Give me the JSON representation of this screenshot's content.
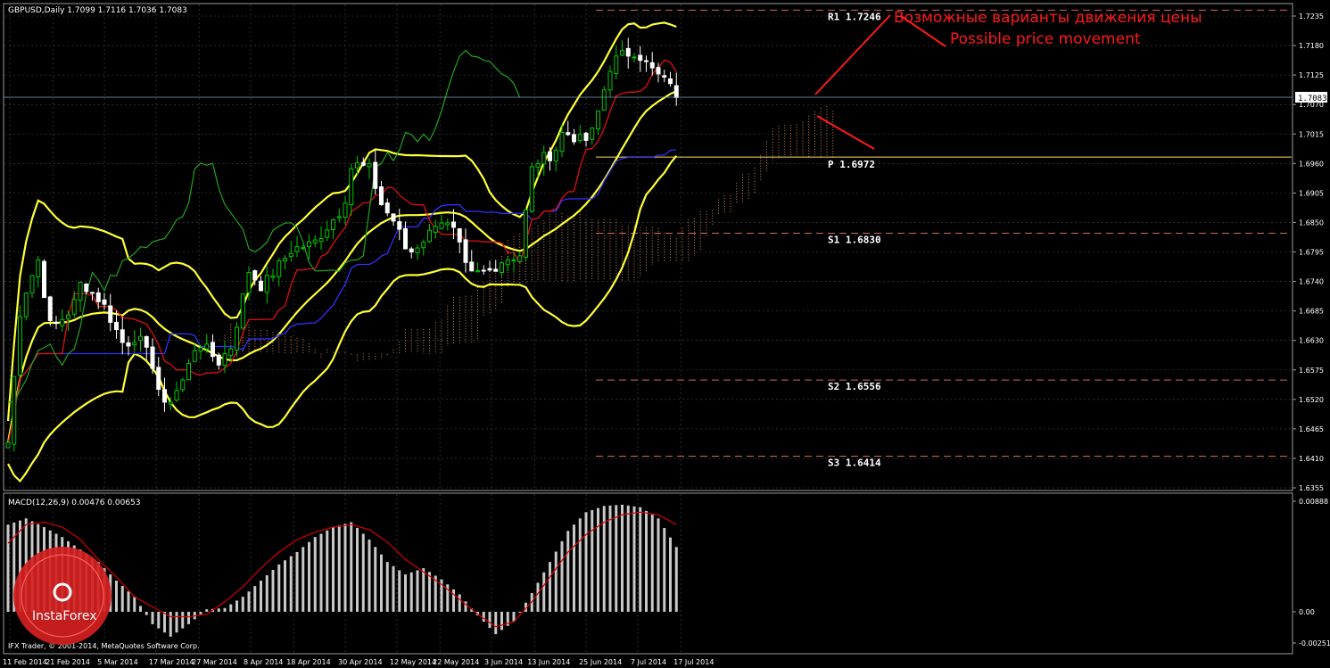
{
  "header": {
    "symbol_line": "GBPUSD,Daily  1.7099 1.7116 1.7036 1.7083",
    "macd_line": "MACD(12,26,9) 0.00476 0.00653",
    "copyright": "IFX Trader, © 2001-2014, MetaQuotes Software Corp."
  },
  "annotation": {
    "ru": "Возможные варианты движения цены",
    "en": "Possible price movement"
  },
  "logo": {
    "text": "InstaForex"
  },
  "colors": {
    "background": "#000000",
    "grid": "#4a4a4a",
    "bullish": "#00c800",
    "bearish": "#ffffff",
    "bollinger": "#ffff33",
    "chikou": "#1fa51f",
    "kijun": "#3030ff",
    "tenkan": "#e01010",
    "cloud": "#d48a5a",
    "annotation": "#ff1a1a",
    "macd_signal": "#d40000",
    "macd_hist": "#c8c8c8"
  },
  "chart_data": [
    {
      "type": "candlestick",
      "symbol": "GBPUSD",
      "timeframe": "Daily",
      "y_range": [
        1.635,
        1.726
      ],
      "y_ticks": [
        "1.7235",
        "1.7180",
        "1.7125",
        "1.7070",
        "1.7015",
        "1.6960",
        "1.6905",
        "1.6850",
        "1.6795",
        "1.6740",
        "1.6685",
        "1.6630",
        "1.6575",
        "1.6520",
        "1.6465",
        "1.6410",
        "1.6355"
      ],
      "current_price": "1.7083",
      "x_ticks": [
        "11 Feb 2014",
        "21 Feb 2014",
        "5 Mar 2014",
        "17 Mar 2014",
        "27 Mar 2014",
        "8 Apr 2014",
        "18 Apr 2014",
        "30 Apr 2014",
        "12 May 2014",
        "22 May 2014",
        "3 Jun 2014",
        "13 Jun 2014",
        "25 Jun 2014",
        "7 Jul 2014",
        "17 Jul 2014"
      ],
      "pivot_levels": [
        {
          "label": "R1",
          "value": "1.7246"
        },
        {
          "label": "P",
          "value": "1.6972"
        },
        {
          "label": "S1",
          "value": "1.6830"
        },
        {
          "label": "S2",
          "value": "1.6556"
        },
        {
          "label": "S3",
          "value": "1.6414"
        }
      ],
      "close_path": [
        {
          "date": "11 Feb 2014",
          "close": 1.644
        },
        {
          "date": "14 Feb 2014",
          "close": 1.67
        },
        {
          "date": "18 Feb 2014",
          "close": 1.678
        },
        {
          "date": "21 Feb 2014",
          "close": 1.665
        },
        {
          "date": "26 Feb 2014",
          "close": 1.669
        },
        {
          "date": "28 Feb 2014",
          "close": 1.674
        },
        {
          "date": "5 Mar 2014",
          "close": 1.67
        },
        {
          "date": "10 Mar 2014",
          "close": 1.662
        },
        {
          "date": "13 Mar 2014",
          "close": 1.664
        },
        {
          "date": "17 Mar 2014",
          "close": 1.658
        },
        {
          "date": "19 Mar 2014",
          "close": 1.65
        },
        {
          "date": "24 Mar 2014",
          "close": 1.656
        },
        {
          "date": "27 Mar 2014",
          "close": 1.663
        },
        {
          "date": "1 Apr 2014",
          "close": 1.659
        },
        {
          "date": "4 Apr 2014",
          "close": 1.662
        },
        {
          "date": "8 Apr 2014",
          "close": 1.676
        },
        {
          "date": "11 Apr 2014",
          "close": 1.673
        },
        {
          "date": "15 Apr 2014",
          "close": 1.677
        },
        {
          "date": "18 Apr 2014",
          "close": 1.68
        },
        {
          "date": "23 Apr 2014",
          "close": 1.681
        },
        {
          "date": "25 Apr 2014",
          "close": 1.683
        },
        {
          "date": "30 Apr 2014",
          "close": 1.688
        },
        {
          "date": "2 May 2014",
          "close": 1.696
        },
        {
          "date": "6 May 2014",
          "close": 1.695
        },
        {
          "date": "9 May 2014",
          "close": 1.688
        },
        {
          "date": "12 May 2014",
          "close": 1.685
        },
        {
          "date": "15 May 2014",
          "close": 1.679
        },
        {
          "date": "20 May 2014",
          "close": 1.683
        },
        {
          "date": "22 May 2014",
          "close": 1.686
        },
        {
          "date": "26 May 2014",
          "close": 1.683
        },
        {
          "date": "29 May 2014",
          "close": 1.675
        },
        {
          "date": "3 Jun 2014",
          "close": 1.676
        },
        {
          "date": "6 Jun 2014",
          "close": 1.678
        },
        {
          "date": "10 Jun 2014",
          "close": 1.679
        },
        {
          "date": "13 Jun 2014",
          "close": 1.696
        },
        {
          "date": "18 Jun 2014",
          "close": 1.698
        },
        {
          "date": "20 Jun 2014",
          "close": 1.702
        },
        {
          "date": "25 Jun 2014",
          "close": 1.7
        },
        {
          "date": "27 Jun 2014",
          "close": 1.702
        },
        {
          "date": "1 Jul 2014",
          "close": 1.714
        },
        {
          "date": "3 Jul 2014",
          "close": 1.716
        },
        {
          "date": "7 Jul 2014",
          "close": 1.717
        },
        {
          "date": "10 Jul 2014",
          "close": 1.714
        },
        {
          "date": "14 Jul 2014",
          "close": 1.711
        },
        {
          "date": "16 Jul 2014",
          "close": 1.712
        },
        {
          "date": "17 Jul 2014",
          "close": 1.7083
        }
      ],
      "indicators": [
        "Bollinger Bands",
        "Ichimoku Kinko Hyo"
      ]
    },
    {
      "type": "bar",
      "name": "MACD(12,26,9)",
      "values_header": [
        "0.00476",
        "0.00653"
      ],
      "y_range": [
        -0.003,
        0.009
      ],
      "y_ticks": [
        "0.00888",
        "0.00",
        "-0.00251"
      ],
      "histogram_path": [
        0.007,
        0.0075,
        0.0068,
        0.006,
        0.005,
        0.004,
        0.0025,
        0.0012,
        -0.001,
        -0.002,
        -0.001,
        0.0002,
        0.0003,
        0.0012,
        0.0025,
        0.0038,
        0.0048,
        0.006,
        0.0068,
        0.0072,
        0.0058,
        0.004,
        0.003,
        0.0035,
        0.0026,
        0.0014,
        -0.0003,
        -0.0018,
        -0.0008,
        0.0015,
        0.004,
        0.0065,
        0.008,
        0.0085,
        0.0086,
        0.0084,
        0.0075,
        0.0052
      ],
      "signal_path": [
        0.0055,
        0.007,
        0.0072,
        0.0068,
        0.0058,
        0.0042,
        0.0028,
        0.0012,
        0.0004,
        -0.0004,
        -0.0004,
        -0.0002,
        0.0008,
        0.002,
        0.0035,
        0.0048,
        0.0058,
        0.0064,
        0.0068,
        0.007,
        0.0066,
        0.0056,
        0.0042,
        0.0032,
        0.0022,
        0.001,
        -0.0002,
        -0.0012,
        -0.0008,
        0.0008,
        0.0028,
        0.0048,
        0.0062,
        0.0072,
        0.0078,
        0.008,
        0.0078,
        0.007
      ]
    }
  ]
}
